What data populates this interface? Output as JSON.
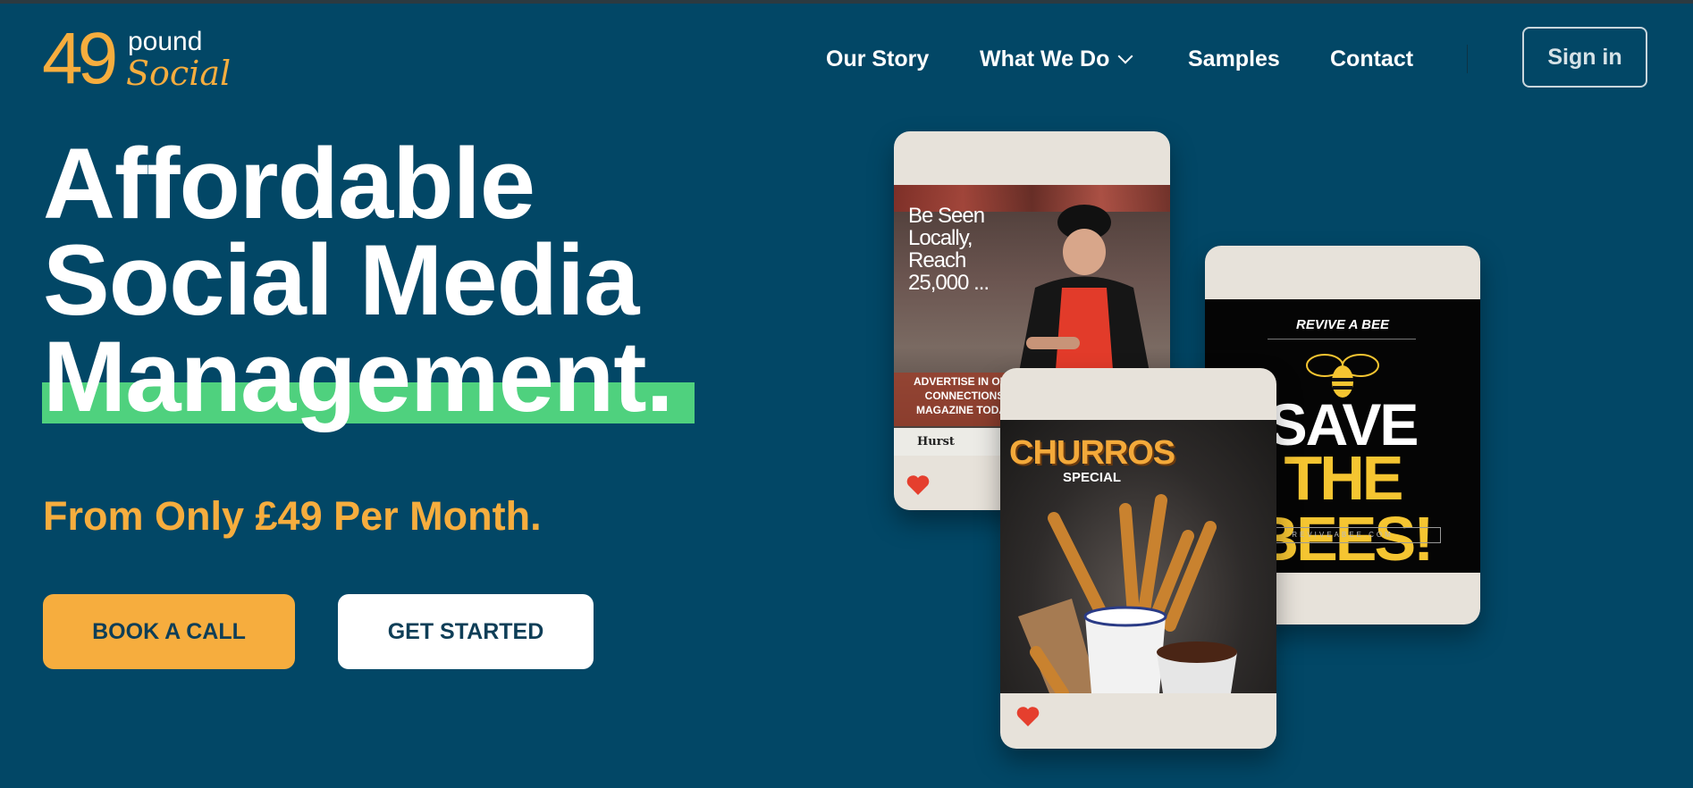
{
  "brand": {
    "number": "49",
    "word1": "pound",
    "word2": "Social",
    "colors": {
      "background": "#024766",
      "accent": "#f6ad3e",
      "highlight": "#4fd17e"
    }
  },
  "nav": {
    "items": [
      "Our Story",
      "What We Do",
      "Samples",
      "Contact"
    ],
    "signin": "Sign in"
  },
  "hero": {
    "line1": "Affordable",
    "line2": "Social Media",
    "line3": "Management.",
    "price": "From Only £49 Per Month.",
    "book_button": "BOOK A CALL",
    "start_button": "GET STARTED"
  },
  "cards": {
    "butcher": {
      "headline": "Be Seen\nLocally,\nReach\n25,000 ...",
      "ad": "ADVERTISE IN OUR CONNECTIONS MAGAZINE TODAY",
      "brand": "Hurst",
      "liked_icon": "heart-icon"
    },
    "bees": {
      "kicker": "REVIVE A BEE",
      "line1": "SAVE",
      "line2": "THE BEES!",
      "url": "REVIVEABEE.COM",
      "liked_icon": "heart-icon"
    },
    "churros": {
      "title": "CHURROS",
      "subtitle": "SPECIAL",
      "liked_icon": "heart-icon"
    }
  }
}
